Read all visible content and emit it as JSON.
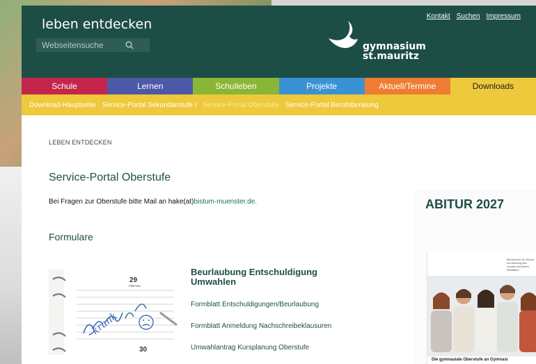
{
  "header": {
    "tagline": "leben entdecken",
    "search_placeholder": "Webseitensuche",
    "logo_line1": "gymnasium",
    "logo_line2": "st.mauritz",
    "top_links": [
      "Kontakt",
      "Suchen",
      "Impressum"
    ]
  },
  "colors": {
    "header_bg": "#1d4e46",
    "nav": [
      "#c4254c",
      "#4d59a8",
      "#8bb535",
      "#3b92d3",
      "#ef7c33",
      "#eec93b"
    ]
  },
  "mainnav": [
    "Schule",
    "Lernen",
    "Schulleben",
    "Projekte",
    "Aktuell/Termine",
    "Downloads"
  ],
  "subnav": [
    "Download-Hauptseite",
    "Service-Portal Sekundarstufe I",
    "Service-Portal Oberstufe",
    "Service-Portal Berufsberatung"
  ],
  "content": {
    "breadcrumb": "LEBEN ENTDECKEN",
    "title": "Service-Portal Oberstufe",
    "info_prefix": "Bei Fragen zur Oberstufe bitte Mail an hake(at)",
    "info_link": "bistum-muenster.de.",
    "section": "Formulare",
    "card_title": "Beurlaubung Entschuldigung Umwahlen",
    "links": [
      "Formblatt Entschuldigungen/Beurlaubung",
      "Formblatt Anmeldung Nachschreibeklausuren",
      "Umwahlantrag Kursplanung Oberstufe"
    ]
  },
  "sidebar": {
    "heading": "ABITUR 2027",
    "flyer_caption": "Die gymnasiale Oberstufe an Gymnasi",
    "flyer_small": "Ministerium für Schule und Bildung des Landes Nordrhein-Westfalen"
  },
  "thumb": {
    "calendar_top": "29",
    "calendar_day": "FREITAG",
    "calendar_bottom": "30",
    "note": "krank"
  }
}
